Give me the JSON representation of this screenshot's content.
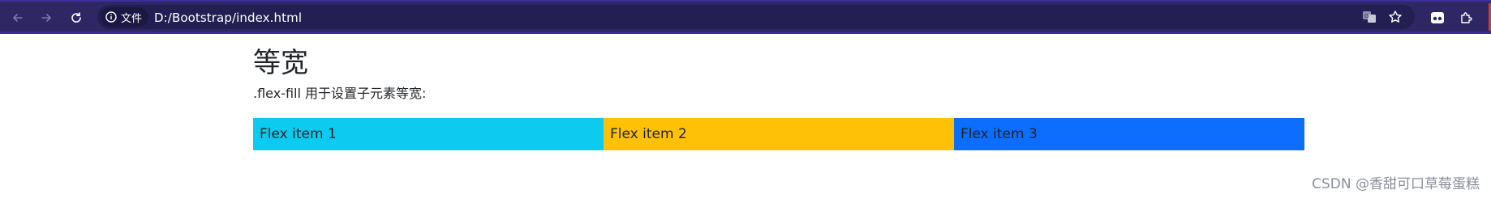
{
  "browser": {
    "chip_label": "文件",
    "url": "D:/Bootstrap/index.html"
  },
  "page": {
    "heading": "等宽",
    "description": ".flex-fill 用于设置子元素等宽:",
    "items": [
      {
        "label": "Flex item 1",
        "color": "#0dcaf0"
      },
      {
        "label": "Flex item 2",
        "color": "#ffc107"
      },
      {
        "label": "Flex item 3",
        "color": "#0d6efd"
      }
    ]
  },
  "watermark": "CSDN @香甜可口草莓蛋糕",
  "colors": {
    "toolbar": "#2e2764",
    "omnibox": "#241f52",
    "text": "#212529"
  }
}
